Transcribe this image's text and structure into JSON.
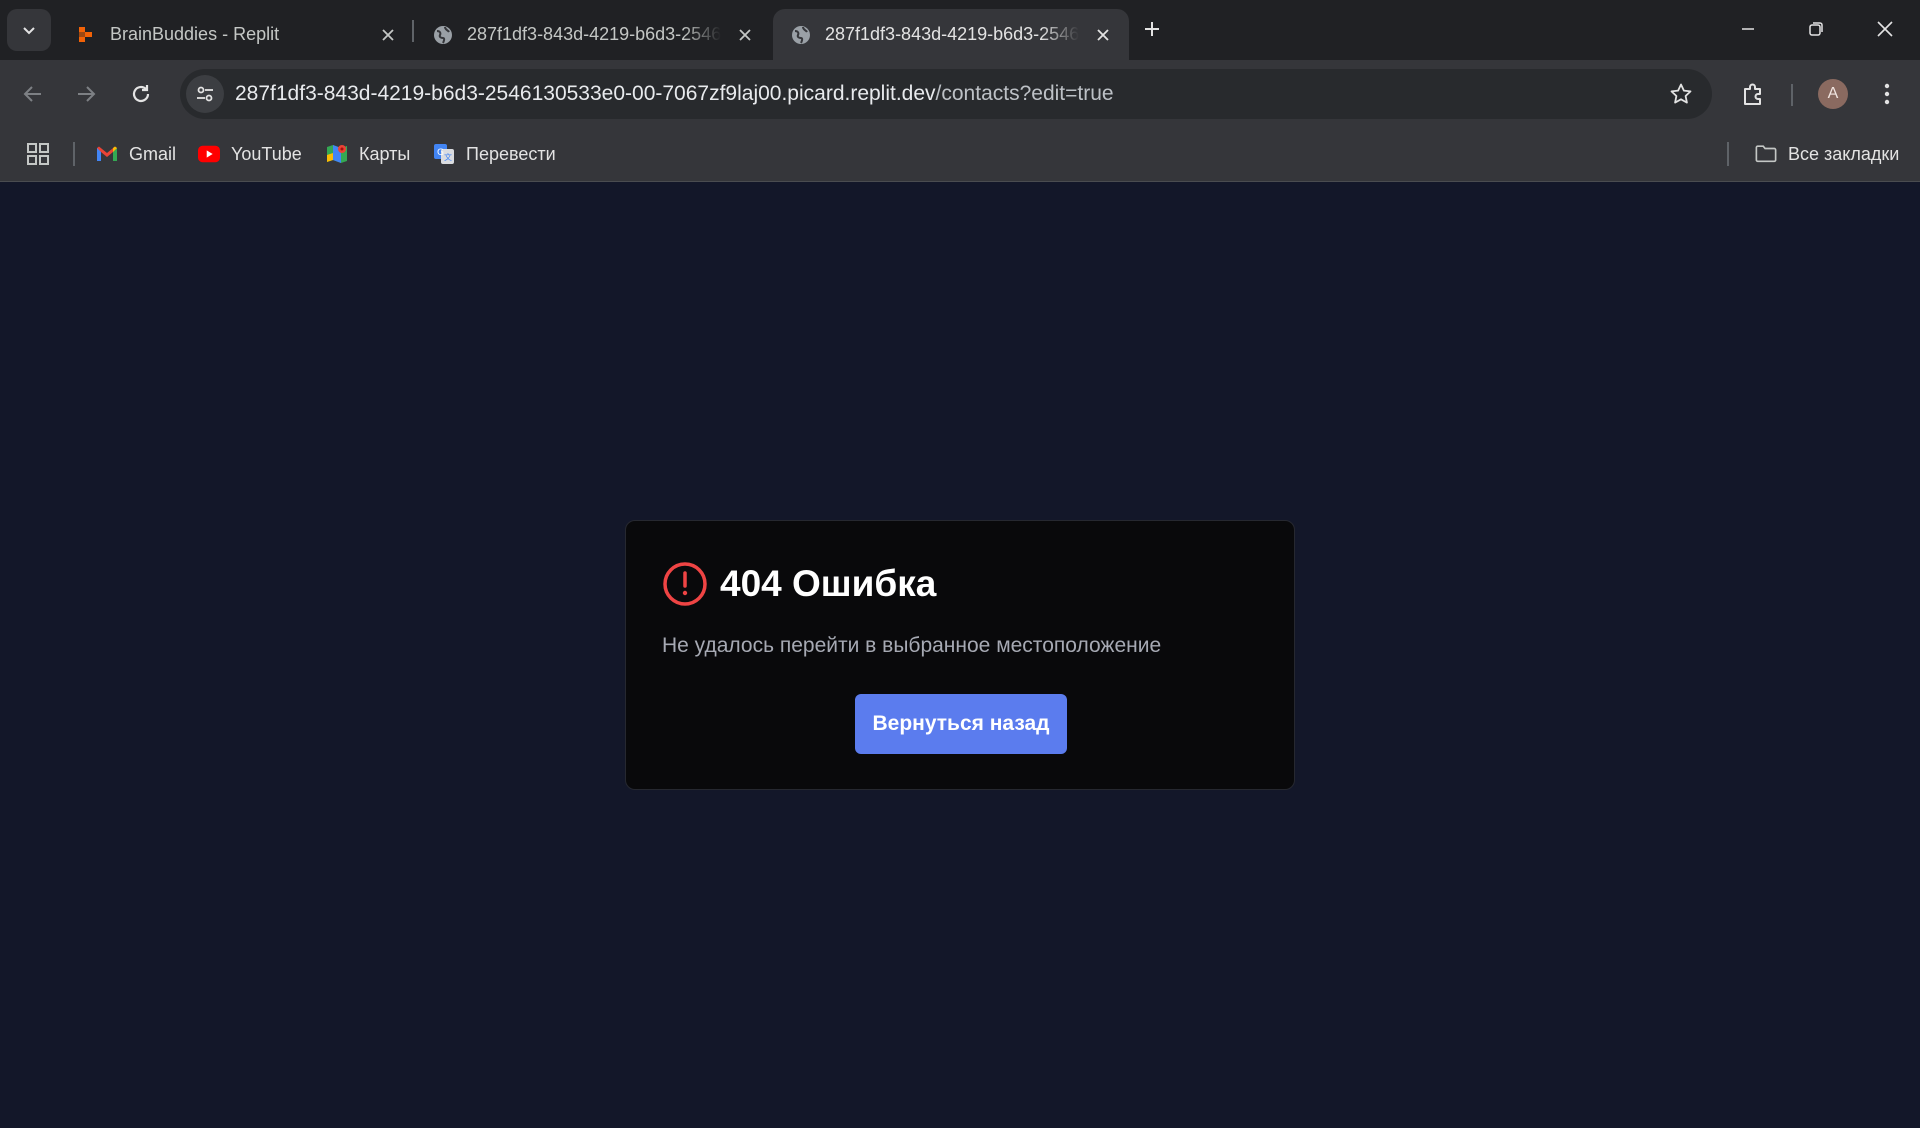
{
  "browser": {
    "tabs": [
      {
        "title": "BrainBuddies - Replit",
        "active": false,
        "favicon": "replit-icon"
      },
      {
        "title": "287f1df3-843d-4219-b6d3-2546130533e0-00-7067zf9laj00.picard.replit.dev",
        "active": false,
        "favicon": "globe-icon"
      },
      {
        "title": "287f1df3-843d-4219-b6d3-2546130533e0-00-7067zf9laj00.picard.replit.dev",
        "active": true,
        "favicon": "globe-icon"
      }
    ],
    "address": {
      "host": "287f1df3-843d-4219-b6d3-2546130533e0-00-7067zf9laj00.picard.replit.dev",
      "path": "/contacts?edit=true"
    },
    "profile_initial": "A",
    "bookmarks": [
      {
        "label": "Gmail",
        "icon": "gmail-icon"
      },
      {
        "label": "YouTube",
        "icon": "youtube-icon"
      },
      {
        "label": "Карты",
        "icon": "maps-icon"
      },
      {
        "label": "Перевести",
        "icon": "translate-icon"
      }
    ],
    "all_bookmarks_label": "Все закладки"
  },
  "page": {
    "error_title": "404 Ошибка",
    "error_message": "Не удалось перейти в выбранное местоположение",
    "back_button_label": "Вернуться назад"
  },
  "colors": {
    "page_background": "#131729",
    "card_background": "#09090b",
    "error_icon": "#ef4444",
    "button": "#5b7cee"
  }
}
